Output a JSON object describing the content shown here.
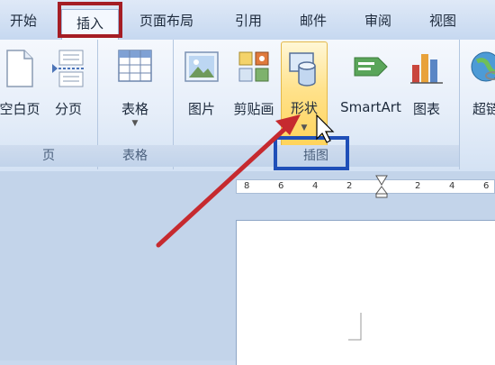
{
  "tabs": {
    "start": "开始",
    "insert": "插入",
    "page_layout": "页面布局",
    "references": "引用",
    "mailings": "邮件",
    "review": "审阅",
    "view": "视图"
  },
  "ribbon": {
    "pages_group": {
      "label": "页",
      "blank_page": "空白页",
      "page_break": "分页"
    },
    "tables_group": {
      "label": "表格",
      "table": "表格"
    },
    "illustrations_group": {
      "label": "插图",
      "picture": "图片",
      "clip_art": "剪贴画",
      "shapes": "形状",
      "smartart": "SmartArt",
      "chart": "图表"
    },
    "links_group": {
      "hyperlink": "超链"
    }
  },
  "ruler_ticks": [
    "8",
    "6",
    "4",
    "2",
    "2",
    "4",
    "6"
  ],
  "colors": {
    "red_highlight": "#a51d24",
    "blue_highlight": "#1f4fb8",
    "arrow": "#c62a2f"
  },
  "annotations": {
    "insert_tab_highlighted": true,
    "illustrations_label_highlighted": true,
    "arrow_to_shapes": true
  }
}
